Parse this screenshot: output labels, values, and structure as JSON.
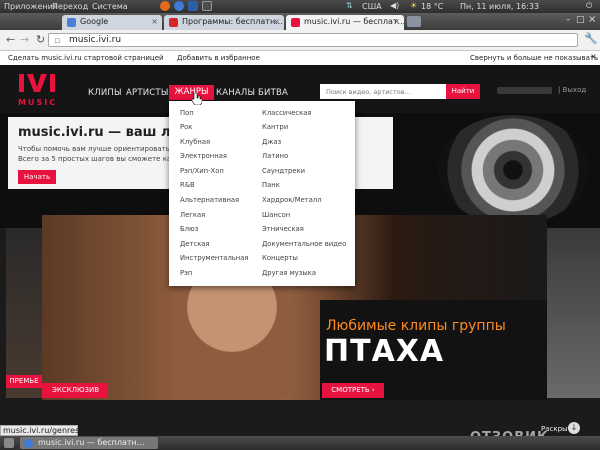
{
  "system_panel": {
    "menu": [
      "Приложения",
      "Переход",
      "Система"
    ],
    "keyboard_layout": "США",
    "weather": "18 °C",
    "clock": "Пн, 11 июля, 16:33"
  },
  "browser": {
    "tabs": [
      {
        "label": "Google",
        "favicon_color": "#4a7fd6",
        "active": false
      },
      {
        "label": "Программы: бесплатн...",
        "favicon_color": "#d62828",
        "active": false
      },
      {
        "label": "music.ivi.ru — бесплат...",
        "favicon_color": "#e8123e",
        "active": true
      }
    ],
    "address": "music.ivi.ru",
    "notice": {
      "make_start": "Сделать music.ivi.ru стартовой страницей",
      "add_favorites": "Добавить в избранное",
      "collapse": "Свернуть и больше не показывать"
    }
  },
  "site": {
    "logo_text": "MUSIC",
    "nav": [
      "КЛИПЫ",
      "АРТИСТЫ",
      "ЖАНРЫ",
      "КАНАЛЫ",
      "БИТВА"
    ],
    "search_placeholder": "Поиск видео, артистов...",
    "search_button": "Найти",
    "logout": "Выход",
    "banner": {
      "title": "music.ivi.ru — ваш личный м",
      "line1": "Чтобы помочь вам лучше ориентироваться к",
      "line2": "Всего за 5 простых шагов вы сможете каче",
      "start_button": "Начать"
    },
    "genres_col1": [
      "Поп",
      "Рок",
      "Клубная",
      "Электронная",
      "Рэп/Хип-Хоп",
      "R&B",
      "Альтернативная",
      "Легкая",
      "Блюз",
      "Детская",
      "Инструментальная",
      "Рэп"
    ],
    "genres_col2": [
      "Классическая",
      "Кантри",
      "Джаз",
      "Латино",
      "Саундтреки",
      "Панк",
      "Хардрок/Металл",
      "Шансон",
      "Этническая",
      "Документальное видео",
      "Концерты",
      "Другая музыка"
    ],
    "feature": {
      "subtitle": "Любимые клипы группы",
      "title": "ПТАХА",
      "watch_button": "СМОТРЕТЬ ›",
      "exclusive": "ЭКСКЛЮЗИВ",
      "premiere": "ПРЕМЬЕ"
    },
    "collapse_link": "Раскрыть"
  },
  "status_bar": {
    "url": "music.ivi.ru/genres"
  },
  "taskbar": {
    "item": "music.ivi.ru — бесплатн..."
  },
  "watermark": "ОТЗОВИК"
}
